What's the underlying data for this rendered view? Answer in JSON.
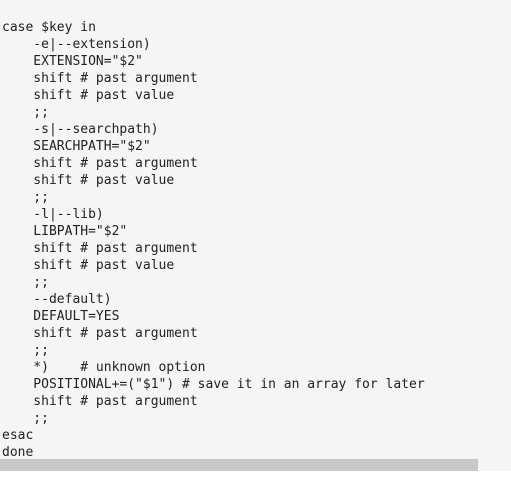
{
  "code": {
    "lines": [
      "case $key in",
      "    -e|--extension)",
      "    EXTENSION=\"$2\"",
      "    shift # past argument",
      "    shift # past value",
      "    ;;",
      "    -s|--searchpath)",
      "    SEARCHPATH=\"$2\"",
      "    shift # past argument",
      "    shift # past value",
      "    ;;",
      "    -l|--lib)",
      "    LIBPATH=\"$2\"",
      "    shift # past argument",
      "    shift # past value",
      "    ;;",
      "    --default)",
      "    DEFAULT=YES",
      "    shift # past argument",
      "    ;;",
      "    *)    # unknown option",
      "    POSITIONAL+=(\"$1\") # save it in an array for later",
      "    shift # past argument",
      "    ;;",
      "esac",
      "done"
    ]
  },
  "scrollbar": {
    "horizontal_thumb_fraction": 0.935
  }
}
